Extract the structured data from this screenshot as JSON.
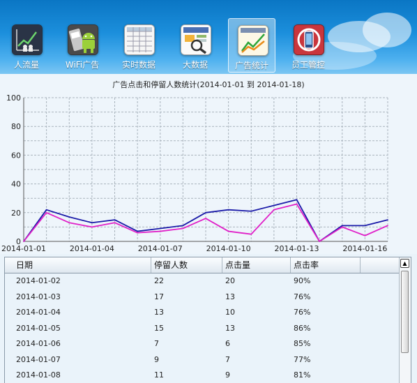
{
  "toolbar": {
    "items": [
      {
        "label": "人流量",
        "icon": "people-flow-chart-icon"
      },
      {
        "label": "WiFi广告",
        "icon": "android-wifi-ad-icon"
      },
      {
        "label": "实时数据",
        "icon": "spreadsheet-icon"
      },
      {
        "label": "大数据",
        "icon": "magnifier-report-icon"
      },
      {
        "label": "广告统计",
        "icon": "line-chart-icon",
        "active": true
      },
      {
        "label": "员工管控",
        "icon": "phone-monitor-icon"
      }
    ]
  },
  "chart_data": {
    "type": "line",
    "title": "广告点击和停留人数统计(2014-01-01 到 2014-01-18)",
    "x": [
      "2014-01-01",
      "2014-01-02",
      "2014-01-03",
      "2014-01-04",
      "2014-01-05",
      "2014-01-06",
      "2014-01-07",
      "2014-01-08",
      "2014-01-09",
      "2014-01-10",
      "2014-01-11",
      "2014-01-12",
      "2014-01-13",
      "2014-01-14",
      "2014-01-15",
      "2014-01-16",
      "2014-01-17"
    ],
    "x_tick_labels": [
      "2014-01-01",
      "2014-01-04",
      "2014-01-07",
      "2014-01-10",
      "2014-01-13",
      "2014-01-16"
    ],
    "ylim": [
      0,
      100
    ],
    "y_ticks": [
      "0",
      "20",
      "40",
      "60",
      "80",
      "100"
    ],
    "grid": true,
    "series": [
      {
        "values": [
          0,
          22,
          17,
          13,
          15,
          7,
          9,
          11,
          20,
          22,
          21,
          25,
          29,
          0,
          11,
          11,
          15
        ],
        "color": "#1a1aa8"
      },
      {
        "values": [
          0,
          20,
          13,
          10,
          13,
          6,
          7,
          9,
          16,
          7,
          5,
          22,
          26,
          0,
          10,
          4,
          11
        ],
        "color": "#e020c8"
      }
    ]
  },
  "table": {
    "columns": [
      "日期",
      "停留人数",
      "点击量",
      "点击率"
    ],
    "rows": [
      [
        "2014-01-02",
        "22",
        "20",
        "90%"
      ],
      [
        "2014-01-03",
        "17",
        "13",
        "76%"
      ],
      [
        "2014-01-04",
        "13",
        "10",
        "76%"
      ],
      [
        "2014-01-05",
        "15",
        "13",
        "86%"
      ],
      [
        "2014-01-06",
        "7",
        "6",
        "85%"
      ],
      [
        "2014-01-07",
        "9",
        "7",
        "77%"
      ],
      [
        "2014-01-08",
        "11",
        "9",
        "81%"
      ]
    ],
    "scroll_up_glyph": "▲"
  }
}
